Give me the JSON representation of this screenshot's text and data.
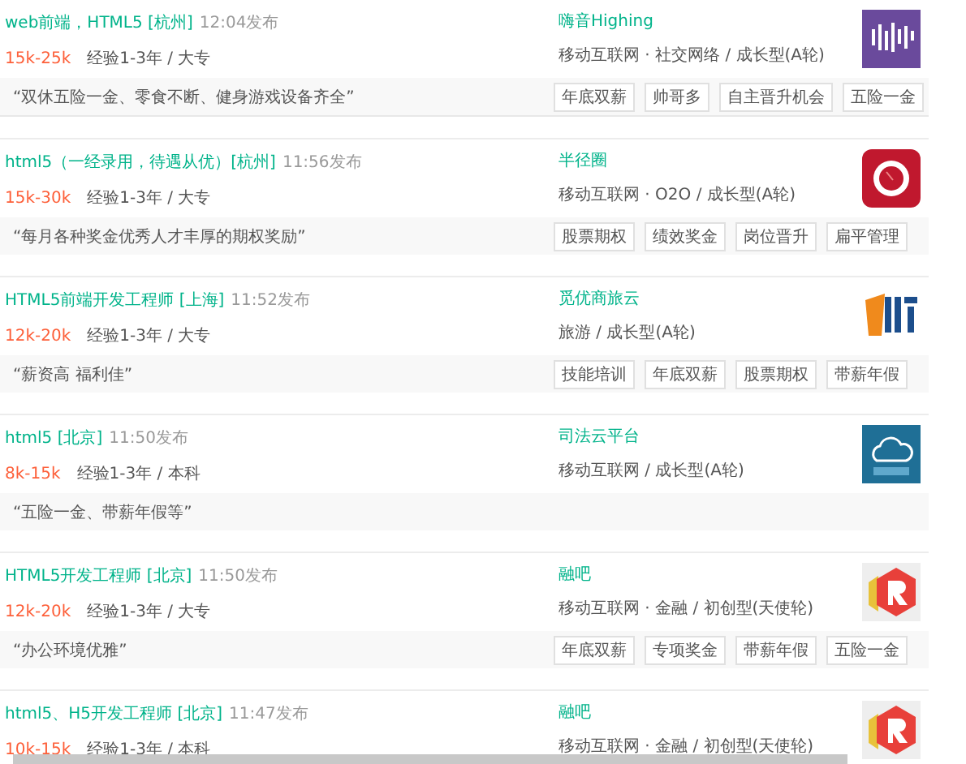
{
  "jobs": [
    {
      "title": "web前端，HTML5 [杭州]",
      "time": "12:04发布",
      "salary": "15k-25k",
      "requirements": "经验1-3年 / 大专",
      "quote": "“双休五险一金、零食不断、健身游戏设备齐全”",
      "company": "嗨音Highing",
      "industry": "移动互联网 · 社交网络 / 成长型(A轮)",
      "logo": {
        "kind": "equalizer"
      },
      "tags": [
        "年底双薪",
        "帅哥多",
        "自主晋升机会",
        "五险一金"
      ]
    },
    {
      "title": "html5（一经录用，待遇从优）[杭州]",
      "time": "11:56发布",
      "salary": "15k-30k",
      "requirements": "经验1-3年 / 大专",
      "quote": "“每月各种奖金优秀人才丰厚的期权奖励”",
      "company": "半径圈",
      "industry": "移动互联网 · O2O / 成长型(A轮)",
      "logo": {
        "kind": "ring"
      },
      "tags": [
        "股票期权",
        "绩效奖金",
        "岗位晋升",
        "扁平管理"
      ]
    },
    {
      "title": "HTML5前端开发工程师 [上海]",
      "time": "11:52发布",
      "salary": "12k-20k",
      "requirements": "经验1-3年 / 大专",
      "quote": "“薪资高 福利佳”",
      "company": "觅优商旅云",
      "industry": "旅游 / 成长型(A轮)",
      "logo": {
        "kind": "flag"
      },
      "tags": [
        "技能培训",
        "年底双薪",
        "股票期权",
        "带薪年假"
      ]
    },
    {
      "title": "html5 [北京]",
      "time": "11:50发布",
      "salary": "8k-15k",
      "requirements": "经验1-3年 / 本科",
      "quote": "“五险一金、带薪年假等”",
      "company": "司法云平台",
      "industry": "移动互联网 / 成长型(A轮)",
      "logo": {
        "kind": "cloud"
      }
    },
    {
      "title": "HTML5开发工程师 [北京]",
      "time": "11:50发布",
      "salary": "12k-20k",
      "requirements": "经验1-3年 / 大专",
      "quote": "“办公环境优雅”",
      "company": "融吧",
      "industry": "移动互联网 · 金融 / 初创型(天使轮)",
      "logo": {
        "kind": "hexagon"
      },
      "tags": [
        "年底双薪",
        "专项奖金",
        "带薪年假",
        "五险一金"
      ]
    },
    {
      "title": "html5、H5开发工程师 [北京]",
      "time": "11:47发布",
      "salary": "10k-15k",
      "requirements": "经验1-3年 / 本科",
      "company": "融吧",
      "industry": "移动互联网 · 金融 / 初创型(天使轮)",
      "logo": {
        "kind": "hexagon"
      }
    }
  ]
}
